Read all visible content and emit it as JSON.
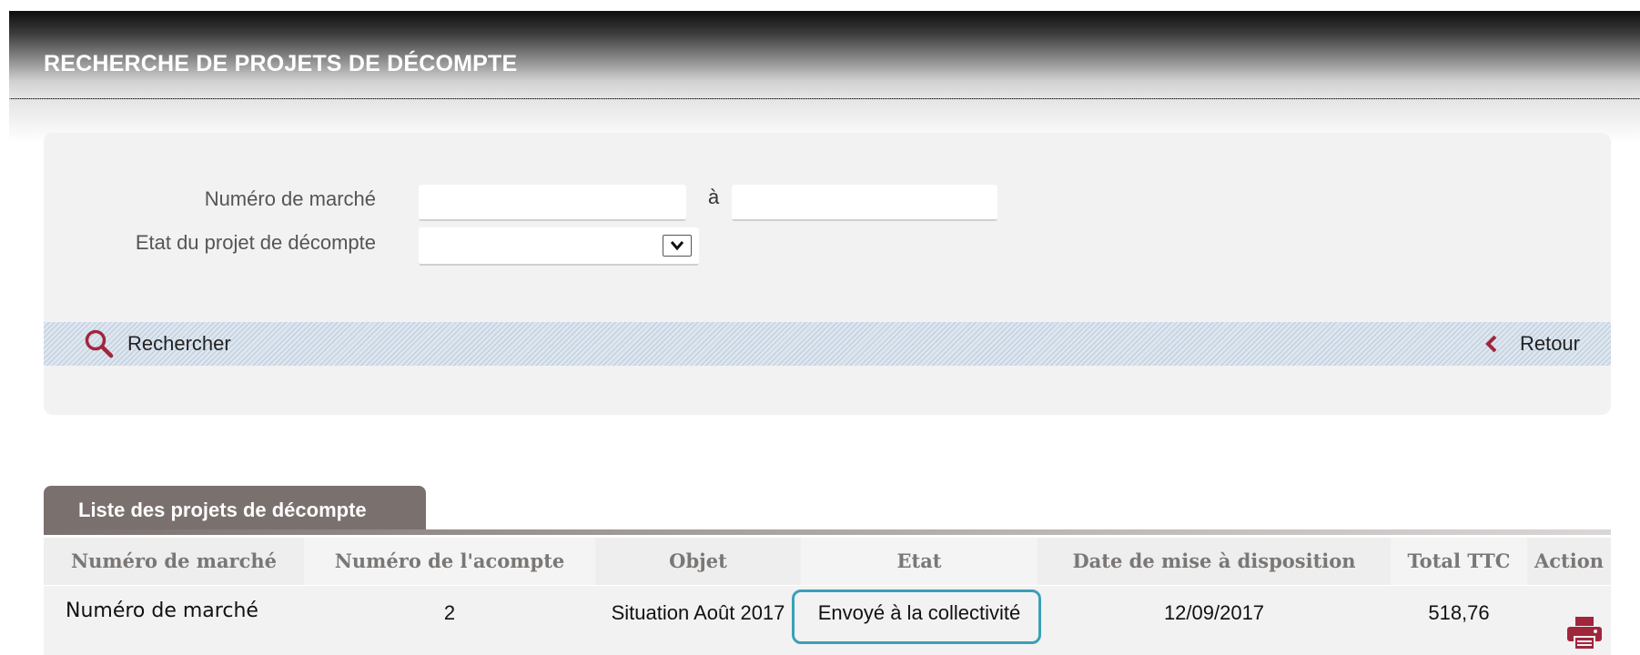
{
  "header": {
    "title": "RECHERCHE DE PROJETS DE DÉCOMPTE"
  },
  "search_form": {
    "numero_marche_label": "Numéro de marché",
    "range_separator": "à",
    "numero_marche_from_value": "",
    "numero_marche_to_value": "",
    "etat_label": "Etat du projet de décompte",
    "etat_selected": ""
  },
  "actions": {
    "search_label": "Rechercher",
    "search_icon": "search-icon",
    "back_label": "Retour",
    "back_icon": "chevron-left-icon"
  },
  "results": {
    "tab_label": "Liste des projets de décompte",
    "columns": [
      "Numéro de marché",
      "Numéro de l'acompte",
      "Objet",
      "Etat",
      "Date de mise à disposition",
      "Total TTC",
      "Action"
    ],
    "rows": [
      {
        "numero_marche": "Numéro de marché",
        "numero_acompte": "2",
        "objet": "Situation Août 2017",
        "etat": "Envoyé à la collectivité",
        "date_mise_a_disposition": "12/09/2017",
        "total_ttc": "518,76",
        "action_icon": "print-icon"
      }
    ]
  },
  "colors": {
    "accent": "#a0263c",
    "highlight_border": "#3aa0b8",
    "tab_background": "#7a716e"
  }
}
